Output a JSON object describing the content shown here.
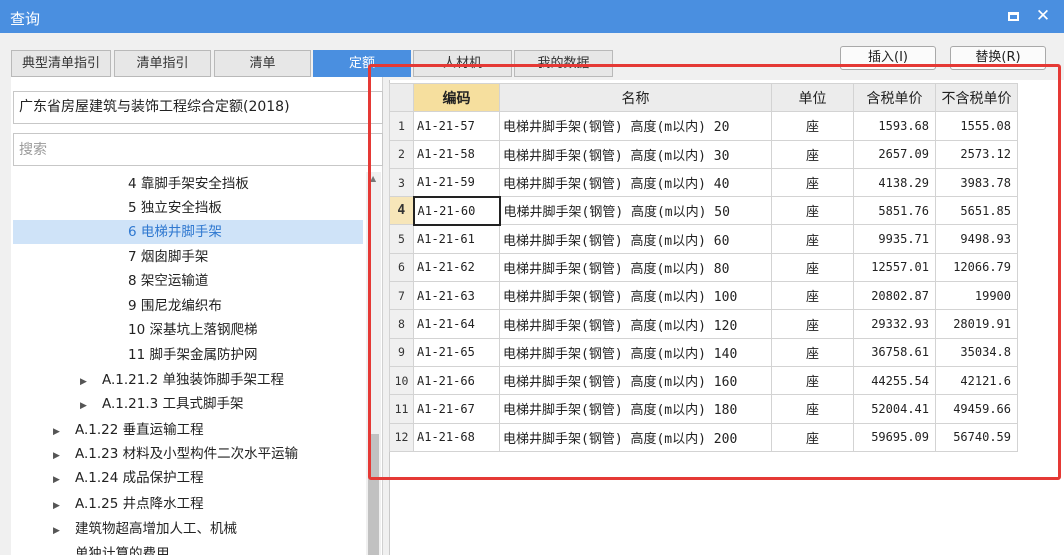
{
  "window": {
    "title": "查询"
  },
  "tabs": [
    {
      "label": "典型清单指引",
      "active": false
    },
    {
      "label": "清单指引",
      "active": false
    },
    {
      "label": "清单",
      "active": false
    },
    {
      "label": "定额",
      "active": true
    },
    {
      "label": "人材机",
      "active": false
    },
    {
      "label": "我的数据",
      "active": false
    }
  ],
  "actions": {
    "insert": "插入(I)",
    "replace": "替换(R)"
  },
  "left": {
    "library": "广东省房屋建筑与装饰工程综合定额(2018)",
    "search_placeholder": "搜索",
    "tree": [
      {
        "label": "4 靠脚手架安全挡板",
        "expander": false
      },
      {
        "label": "5 独立安全挡板",
        "expander": false
      },
      {
        "label": "6 电梯井脚手架",
        "expander": false,
        "selected": true
      },
      {
        "label": "7 烟囱脚手架",
        "expander": false
      },
      {
        "label": "8 架空运输道",
        "expander": false
      },
      {
        "label": "9 围尼龙编织布",
        "expander": false
      },
      {
        "label": "10 深基坑上落钢爬梯",
        "expander": false
      },
      {
        "label": "11 脚手架金属防护网",
        "expander": false
      },
      {
        "label": "A.1.21.2 单独装饰脚手架工程",
        "expander": true
      },
      {
        "label": "A.1.21.3 工具式脚手架",
        "expander": true
      },
      {
        "label": "A.1.22 垂直运输工程",
        "expander": true
      },
      {
        "label": "A.1.23 材料及小型构件二次水平运输",
        "expander": true
      },
      {
        "label": "A.1.24 成品保护工程",
        "expander": true
      },
      {
        "label": "A.1.25 井点降水工程",
        "expander": true
      },
      {
        "label": "建筑物超高增加人工、机械",
        "expander": true
      },
      {
        "label": "单独计算的费用",
        "expander": false
      }
    ]
  },
  "grid": {
    "headers": {
      "code": "编码",
      "name": "名称",
      "unit": "单位",
      "price_tax": "含税单价",
      "price_notax": "不含税单价"
    },
    "current_row": 4,
    "rows": [
      {
        "n": "1",
        "code": "A1-21-57",
        "name": "电梯井脚手架(钢管) 高度(m以内) 20",
        "unit": "座",
        "price_tax": "1593.68",
        "price_notax": "1555.08"
      },
      {
        "n": "2",
        "code": "A1-21-58",
        "name": "电梯井脚手架(钢管) 高度(m以内) 30",
        "unit": "座",
        "price_tax": "2657.09",
        "price_notax": "2573.12"
      },
      {
        "n": "3",
        "code": "A1-21-59",
        "name": "电梯井脚手架(钢管) 高度(m以内) 40",
        "unit": "座",
        "price_tax": "4138.29",
        "price_notax": "3983.78"
      },
      {
        "n": "4",
        "code": "A1-21-60",
        "name": "电梯井脚手架(钢管) 高度(m以内) 50",
        "unit": "座",
        "price_tax": "5851.76",
        "price_notax": "5651.85"
      },
      {
        "n": "5",
        "code": "A1-21-61",
        "name": "电梯井脚手架(钢管) 高度(m以内) 60",
        "unit": "座",
        "price_tax": "9935.71",
        "price_notax": "9498.93"
      },
      {
        "n": "6",
        "code": "A1-21-62",
        "name": "电梯井脚手架(钢管) 高度(m以内) 80",
        "unit": "座",
        "price_tax": "12557.01",
        "price_notax": "12066.79"
      },
      {
        "n": "7",
        "code": "A1-21-63",
        "name": "电梯井脚手架(钢管) 高度(m以内) 100",
        "unit": "座",
        "price_tax": "20802.87",
        "price_notax": "19900"
      },
      {
        "n": "8",
        "code": "A1-21-64",
        "name": "电梯井脚手架(钢管) 高度(m以内) 120",
        "unit": "座",
        "price_tax": "29332.93",
        "price_notax": "28019.91"
      },
      {
        "n": "9",
        "code": "A1-21-65",
        "name": "电梯井脚手架(钢管) 高度(m以内) 140",
        "unit": "座",
        "price_tax": "36758.61",
        "price_notax": "35034.8"
      },
      {
        "n": "10",
        "code": "A1-21-66",
        "name": "电梯井脚手架(钢管) 高度(m以内) 160",
        "unit": "座",
        "price_tax": "44255.54",
        "price_notax": "42121.6"
      },
      {
        "n": "11",
        "code": "A1-21-67",
        "name": "电梯井脚手架(钢管) 高度(m以内) 180",
        "unit": "座",
        "price_tax": "52004.41",
        "price_notax": "49459.66"
      },
      {
        "n": "12",
        "code": "A1-21-68",
        "name": "电梯井脚手架(钢管) 高度(m以内) 200",
        "unit": "座",
        "price_tax": "59695.09",
        "price_notax": "56740.59"
      }
    ]
  },
  "colors": {
    "accent": "#4a8fe0",
    "highlight": "#e53935",
    "selected_bg": "#cfe3f8",
    "code_header": "#f6df9e"
  }
}
